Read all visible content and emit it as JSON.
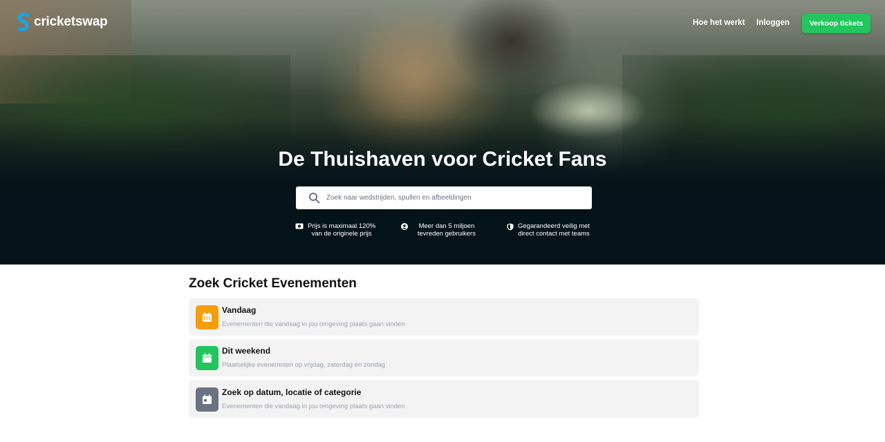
{
  "header": {
    "brand": "cricketswap",
    "nav": {
      "how_it_works": "Hoe het werkt",
      "login": "Inloggen"
    },
    "sell_button": "Verkoop tickets"
  },
  "hero": {
    "title": "De Thuishaven voor Cricket Fans",
    "search": {
      "placeholder": "Zoek naar wedstrijden, spullen en afbeeldingen",
      "value": ""
    },
    "features": [
      {
        "icon": "cash-icon",
        "line1": "Prijs is maximaal 120%",
        "line2": "van de originele prijs"
      },
      {
        "icon": "user-icon",
        "line1": "Meer dan 5 miljoen",
        "line2": "tevreden gebruikers"
      },
      {
        "icon": "shield-icon",
        "line1": "Gegarandeerd veilig met",
        "line2": "direct contact met teams"
      }
    ]
  },
  "events": {
    "title": "Zoek Cricket Evenementen",
    "items": [
      {
        "title": "Vandaag",
        "desc": "Evenementen die vandaag in jou omgeving plaats gaan vinden",
        "icon": "calendar-grid-icon",
        "color": "#f59e0b"
      },
      {
        "title": "Dit weekend",
        "desc": "Plaatselijke evenemnten op vrijdag, zaterdag en zondag",
        "icon": "calendar-weekend-icon",
        "color": "#22c55e"
      },
      {
        "title": "Zoek op datum, locatie of categorie",
        "desc": "Evenementen die vandaag in jou omgeving plaats gaan vinden",
        "icon": "calendar-date-icon",
        "color": "#6b7280"
      }
    ]
  },
  "colors": {
    "accent": "#22c55e",
    "hero_dark": "#04131a",
    "logo_blue": "#1fa2e0"
  }
}
